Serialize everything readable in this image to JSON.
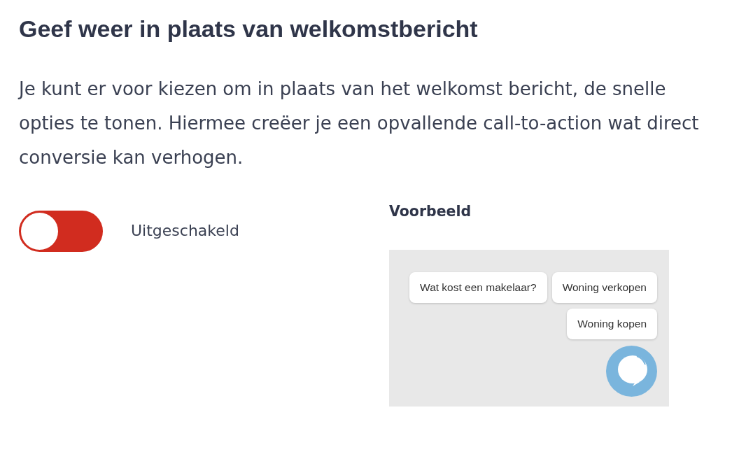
{
  "section": {
    "title": "Geef weer in plaats van welkomstbericht",
    "description": "Je kunt er voor kiezen om in plaats van het welkomst bericht, de snelle opties te tonen. Hiermee creëer je een opvallende call-to-action wat direct conversie kan verhogen."
  },
  "toggle": {
    "on": false,
    "label": "Uitgeschakeld"
  },
  "preview": {
    "title": "Voorbeeld",
    "quick_replies": [
      "Wat kost een makelaar?",
      "Woning verkopen",
      "Woning kopen"
    ]
  }
}
